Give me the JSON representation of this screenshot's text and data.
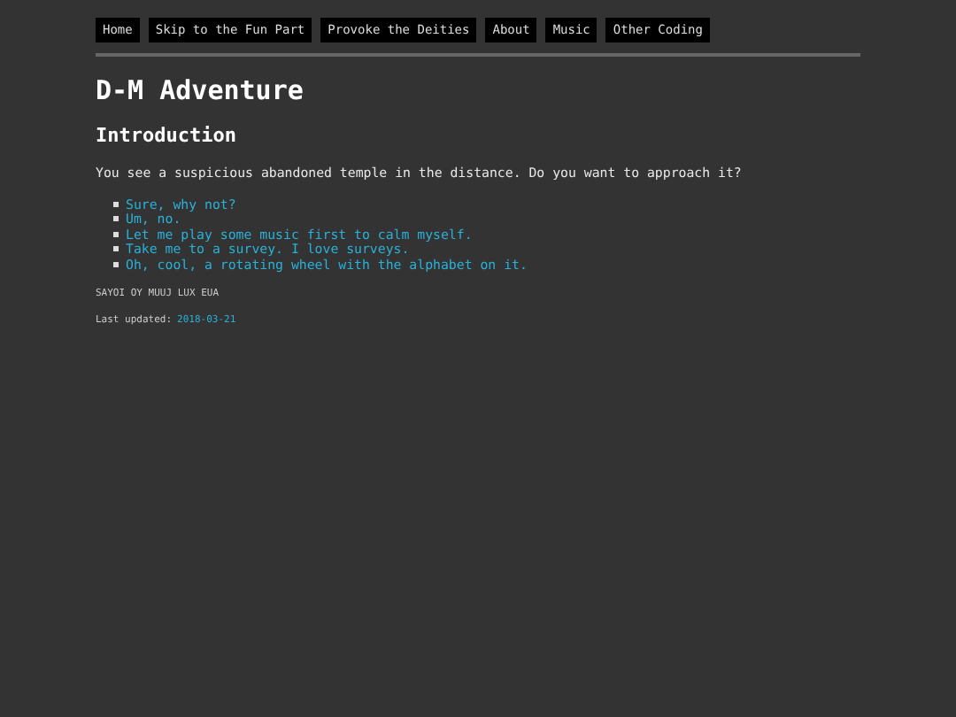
{
  "nav": [
    "Home",
    "Skip to the Fun Part",
    "Provoke the Deities",
    "About",
    "Music",
    "Other Coding"
  ],
  "title": "D-M Adventure",
  "heading": "Introduction",
  "intro": "You see a suspicious abandoned temple in the distance. Do you want to approach it?",
  "choices": [
    "Sure, why not?",
    "Um, no.",
    "Let me play some music first to calm myself.",
    "Take me to a survey. I love surveys.",
    "Oh, cool, a rotating wheel with the alphabet on it."
  ],
  "cipher": "SAYOI OY MUUJ LUX EUA",
  "updated": {
    "label": "Last updated:",
    "date": "2018-03-21"
  }
}
